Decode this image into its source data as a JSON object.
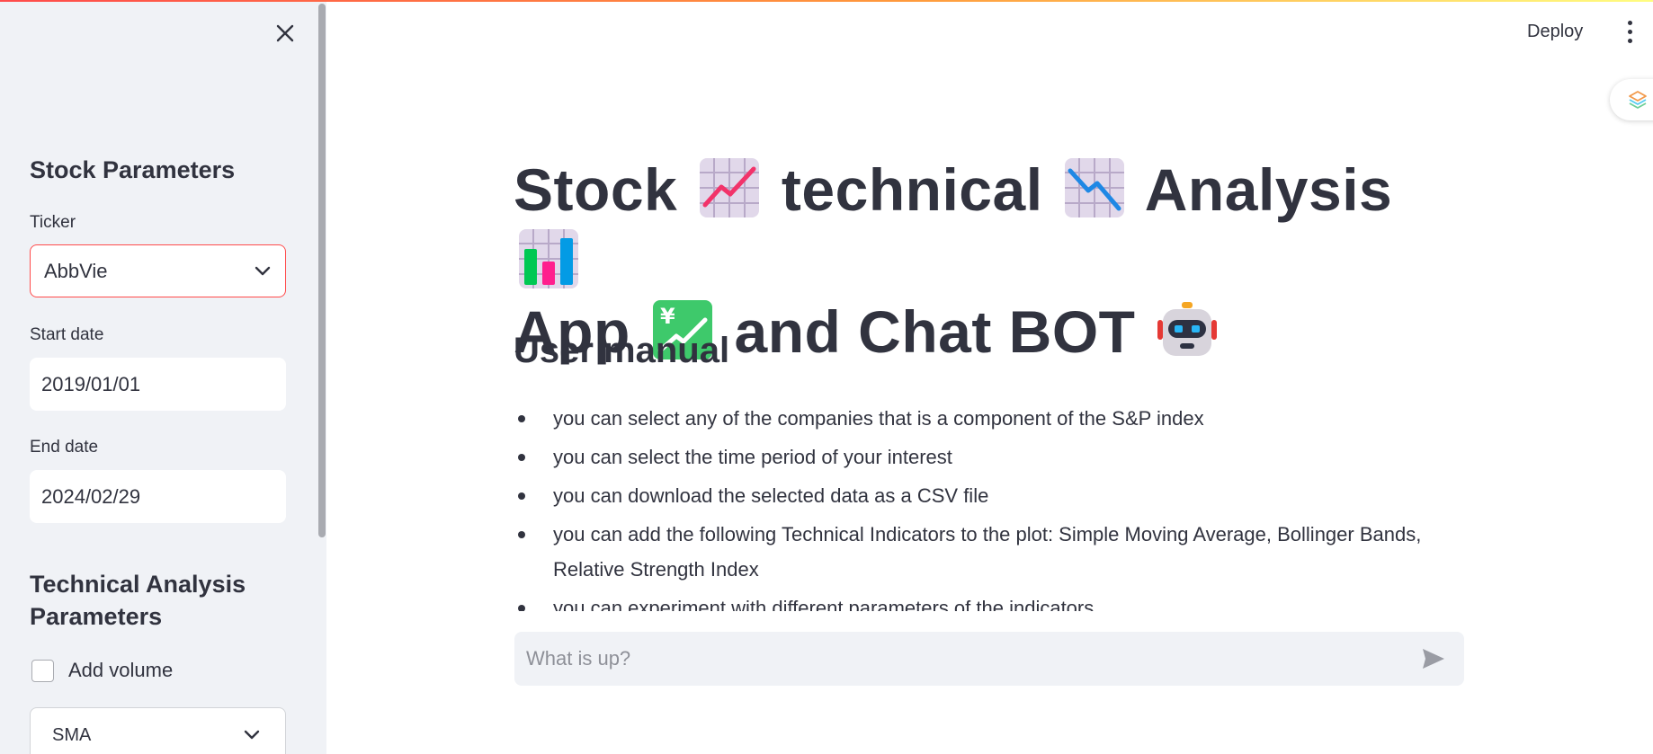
{
  "sidebar": {
    "stock_params_heading": "Stock Parameters",
    "ticker_label": "Ticker",
    "ticker_value": "AbbVie",
    "start_date_label": "Start date",
    "start_date_value": "2019/01/01",
    "end_date_label": "End date",
    "end_date_value": "2024/02/29",
    "ta_params_heading": "Technical Analysis Parameters",
    "add_volume_label": "Add volume",
    "indicator_select_value": "SMA"
  },
  "header": {
    "deploy_label": "Deploy"
  },
  "main": {
    "title_parts": [
      "Stock",
      "technical",
      "Analysis",
      "App",
      "and Chat BOT"
    ],
    "title_icons": [
      "chart-increasing-icon",
      "chart-decreasing-icon",
      "bar-chart-icon",
      "chart-yen-icon",
      "robot-icon"
    ],
    "subheading": "User manual",
    "manual_items": [
      "you can select any of the companies that is a component of the S&P index",
      "you can select the time period of your interest",
      "you can download the selected data as a CSV file",
      "you can add the following Technical Indicators to the plot: Simple Moving Average, Bollinger Bands, Relative Strength Index",
      "you can experiment with different parameters of the indicators"
    ]
  },
  "chat": {
    "placeholder": "What is up?"
  },
  "colors": {
    "accent": "#ff4b4b",
    "sidebar_bg": "#f0f2f6",
    "text": "#31333f"
  }
}
